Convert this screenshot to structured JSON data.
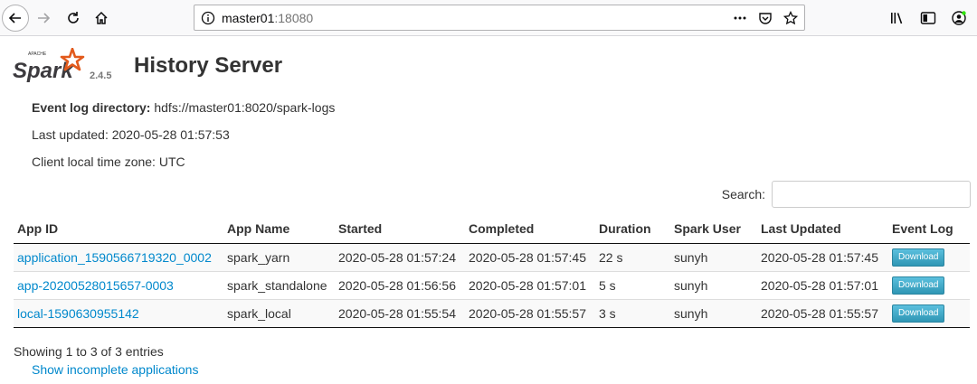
{
  "browser": {
    "url_host": "master01",
    "url_port": ":18080"
  },
  "header": {
    "logo_label": "APACHE",
    "logo_word": "Spark",
    "version": "2.4.5",
    "title": "History Server"
  },
  "info": {
    "event_log_label": "Event log directory:",
    "event_log_value": "hdfs://master01:8020/spark-logs",
    "last_updated": "Last updated: 2020-05-28 01:57:53",
    "timezone": "Client local time zone: UTC"
  },
  "search": {
    "label": "Search:",
    "value": "",
    "placeholder": ""
  },
  "table": {
    "columns": [
      "App ID",
      "App Name",
      "Started",
      "Completed",
      "Duration",
      "Spark User",
      "Last Updated",
      "Event Log"
    ],
    "rows": [
      {
        "app_id": "application_1590566719320_0002",
        "app_name": "spark_yarn",
        "started": "2020-05-28 01:57:24",
        "completed": "2020-05-28 01:57:45",
        "duration": "22 s",
        "user": "sunyh",
        "last_updated": "2020-05-28 01:57:45",
        "event_log": "Download"
      },
      {
        "app_id": "app-20200528015657-0003",
        "app_name": "spark_standalone",
        "started": "2020-05-28 01:56:56",
        "completed": "2020-05-28 01:57:01",
        "duration": "5 s",
        "user": "sunyh",
        "last_updated": "2020-05-28 01:57:01",
        "event_log": "Download"
      },
      {
        "app_id": "local-1590630955142",
        "app_name": "spark_local",
        "started": "2020-05-28 01:55:54",
        "completed": "2020-05-28 01:55:57",
        "duration": "3 s",
        "user": "sunyh",
        "last_updated": "2020-05-28 01:55:57",
        "event_log": "Download"
      }
    ]
  },
  "footer": {
    "entries_info": "Showing 1 to 3 of 3 entries",
    "incomplete_link": "Show incomplete applications"
  },
  "colors": {
    "link": "#0088cc",
    "logo_orange": "#e25a1c",
    "button": "#2f96b4"
  }
}
